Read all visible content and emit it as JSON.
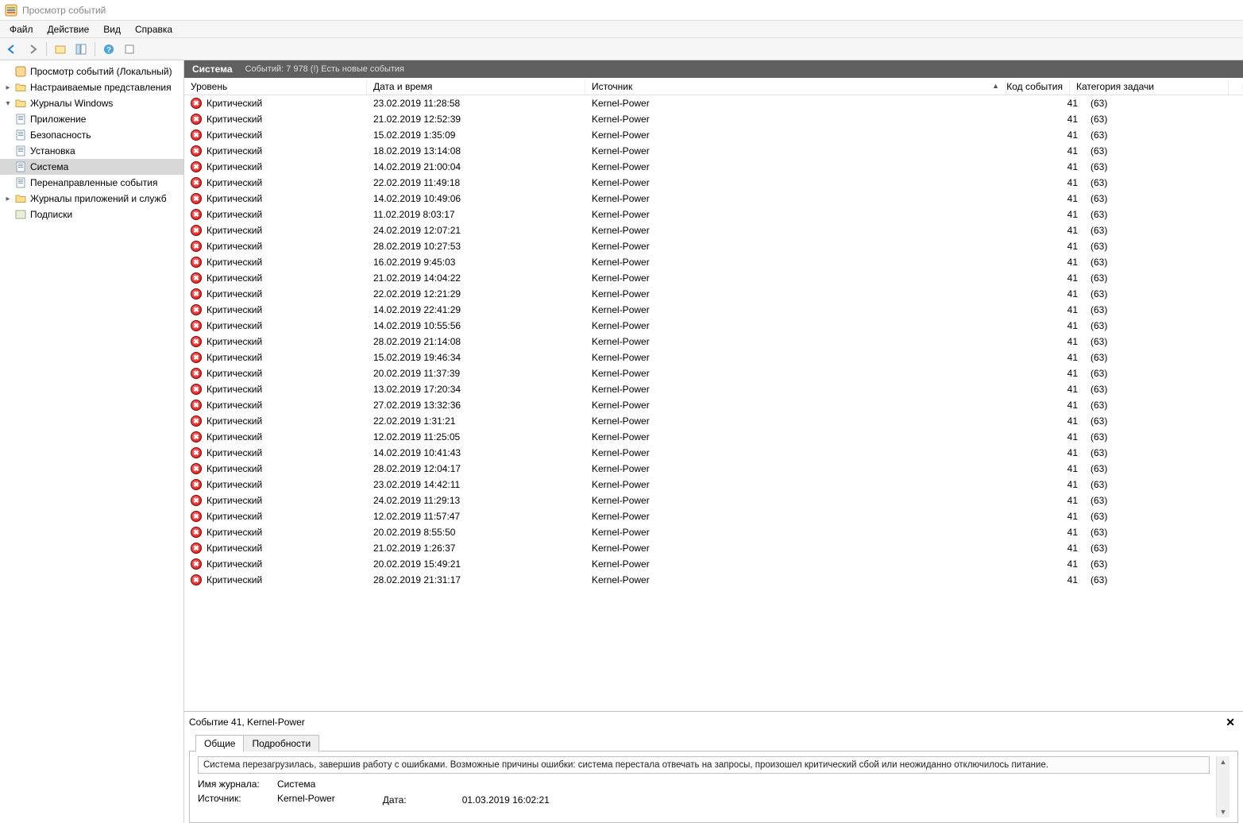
{
  "window": {
    "title": "Просмотр событий"
  },
  "menubar": {
    "file": "Файл",
    "action": "Действие",
    "view": "Вид",
    "help": "Справка"
  },
  "tree": {
    "root": "Просмотр событий (Локальный)",
    "custom_views": "Настраиваемые представления",
    "windows_logs": "Журналы Windows",
    "app_log": "Приложение",
    "security_log": "Безопасность",
    "setup_log": "Установка",
    "system_log": "Система",
    "forwarded_log": "Перенаправленные события",
    "app_services_logs": "Журналы приложений и служб",
    "subscriptions": "Подписки"
  },
  "section": {
    "title": "Система",
    "subtitle": "Событий: 7 978 (!) Есть новые события"
  },
  "columns": {
    "level": "Уровень",
    "date": "Дата и время",
    "source": "Источник",
    "code": "Код события",
    "category": "Категория задачи"
  },
  "events": [
    {
      "level": "Критический",
      "date": "23.02.2019 11:28:58",
      "source": "Kernel-Power",
      "code": "41",
      "cat": "(63)"
    },
    {
      "level": "Критический",
      "date": "21.02.2019 12:52:39",
      "source": "Kernel-Power",
      "code": "41",
      "cat": "(63)"
    },
    {
      "level": "Критический",
      "date": "15.02.2019 1:35:09",
      "source": "Kernel-Power",
      "code": "41",
      "cat": "(63)"
    },
    {
      "level": "Критический",
      "date": "18.02.2019 13:14:08",
      "source": "Kernel-Power",
      "code": "41",
      "cat": "(63)"
    },
    {
      "level": "Критический",
      "date": "14.02.2019 21:00:04",
      "source": "Kernel-Power",
      "code": "41",
      "cat": "(63)"
    },
    {
      "level": "Критический",
      "date": "22.02.2019 11:49:18",
      "source": "Kernel-Power",
      "code": "41",
      "cat": "(63)"
    },
    {
      "level": "Критический",
      "date": "14.02.2019 10:49:06",
      "source": "Kernel-Power",
      "code": "41",
      "cat": "(63)"
    },
    {
      "level": "Критический",
      "date": "11.02.2019 8:03:17",
      "source": "Kernel-Power",
      "code": "41",
      "cat": "(63)"
    },
    {
      "level": "Критический",
      "date": "24.02.2019 12:07:21",
      "source": "Kernel-Power",
      "code": "41",
      "cat": "(63)"
    },
    {
      "level": "Критический",
      "date": "28.02.2019 10:27:53",
      "source": "Kernel-Power",
      "code": "41",
      "cat": "(63)"
    },
    {
      "level": "Критический",
      "date": "16.02.2019 9:45:03",
      "source": "Kernel-Power",
      "code": "41",
      "cat": "(63)"
    },
    {
      "level": "Критический",
      "date": "21.02.2019 14:04:22",
      "source": "Kernel-Power",
      "code": "41",
      "cat": "(63)"
    },
    {
      "level": "Критический",
      "date": "22.02.2019 12:21:29",
      "source": "Kernel-Power",
      "code": "41",
      "cat": "(63)"
    },
    {
      "level": "Критический",
      "date": "14.02.2019 22:41:29",
      "source": "Kernel-Power",
      "code": "41",
      "cat": "(63)"
    },
    {
      "level": "Критический",
      "date": "14.02.2019 10:55:56",
      "source": "Kernel-Power",
      "code": "41",
      "cat": "(63)"
    },
    {
      "level": "Критический",
      "date": "28.02.2019 21:14:08",
      "source": "Kernel-Power",
      "code": "41",
      "cat": "(63)"
    },
    {
      "level": "Критический",
      "date": "15.02.2019 19:46:34",
      "source": "Kernel-Power",
      "code": "41",
      "cat": "(63)"
    },
    {
      "level": "Критический",
      "date": "20.02.2019 11:37:39",
      "source": "Kernel-Power",
      "code": "41",
      "cat": "(63)"
    },
    {
      "level": "Критический",
      "date": "13.02.2019 17:20:34",
      "source": "Kernel-Power",
      "code": "41",
      "cat": "(63)"
    },
    {
      "level": "Критический",
      "date": "27.02.2019 13:32:36",
      "source": "Kernel-Power",
      "code": "41",
      "cat": "(63)"
    },
    {
      "level": "Критический",
      "date": "22.02.2019 1:31:21",
      "source": "Kernel-Power",
      "code": "41",
      "cat": "(63)"
    },
    {
      "level": "Критический",
      "date": "12.02.2019 11:25:05",
      "source": "Kernel-Power",
      "code": "41",
      "cat": "(63)"
    },
    {
      "level": "Критический",
      "date": "14.02.2019 10:41:43",
      "source": "Kernel-Power",
      "code": "41",
      "cat": "(63)"
    },
    {
      "level": "Критический",
      "date": "28.02.2019 12:04:17",
      "source": "Kernel-Power",
      "code": "41",
      "cat": "(63)"
    },
    {
      "level": "Критический",
      "date": "23.02.2019 14:42:11",
      "source": "Kernel-Power",
      "code": "41",
      "cat": "(63)"
    },
    {
      "level": "Критический",
      "date": "24.02.2019 11:29:13",
      "source": "Kernel-Power",
      "code": "41",
      "cat": "(63)"
    },
    {
      "level": "Критический",
      "date": "12.02.2019 11:57:47",
      "source": "Kernel-Power",
      "code": "41",
      "cat": "(63)"
    },
    {
      "level": "Критический",
      "date": "20.02.2019 8:55:50",
      "source": "Kernel-Power",
      "code": "41",
      "cat": "(63)"
    },
    {
      "level": "Критический",
      "date": "21.02.2019 1:26:37",
      "source": "Kernel-Power",
      "code": "41",
      "cat": "(63)"
    },
    {
      "level": "Критический",
      "date": "20.02.2019 15:49:21",
      "source": "Kernel-Power",
      "code": "41",
      "cat": "(63)"
    },
    {
      "level": "Критический",
      "date": "28.02.2019 21:31:17",
      "source": "Kernel-Power",
      "code": "41",
      "cat": "(63)"
    }
  ],
  "details": {
    "title": "Событие 41, Kernel-Power",
    "tab_general": "Общие",
    "tab_details": "Подробности",
    "description": "Система перезагрузилась, завершив работу с ошибками. Возможные причины ошибки: система перестала отвечать на запросы, произошел критический сбой или неожиданно отключилось питание.",
    "label_log": "Имя журнала:",
    "value_log": "Система",
    "label_source": "Источник:",
    "value_source": "Kernel-Power",
    "label_date": "Дата:",
    "value_date": "01.03.2019 16:02:21"
  }
}
